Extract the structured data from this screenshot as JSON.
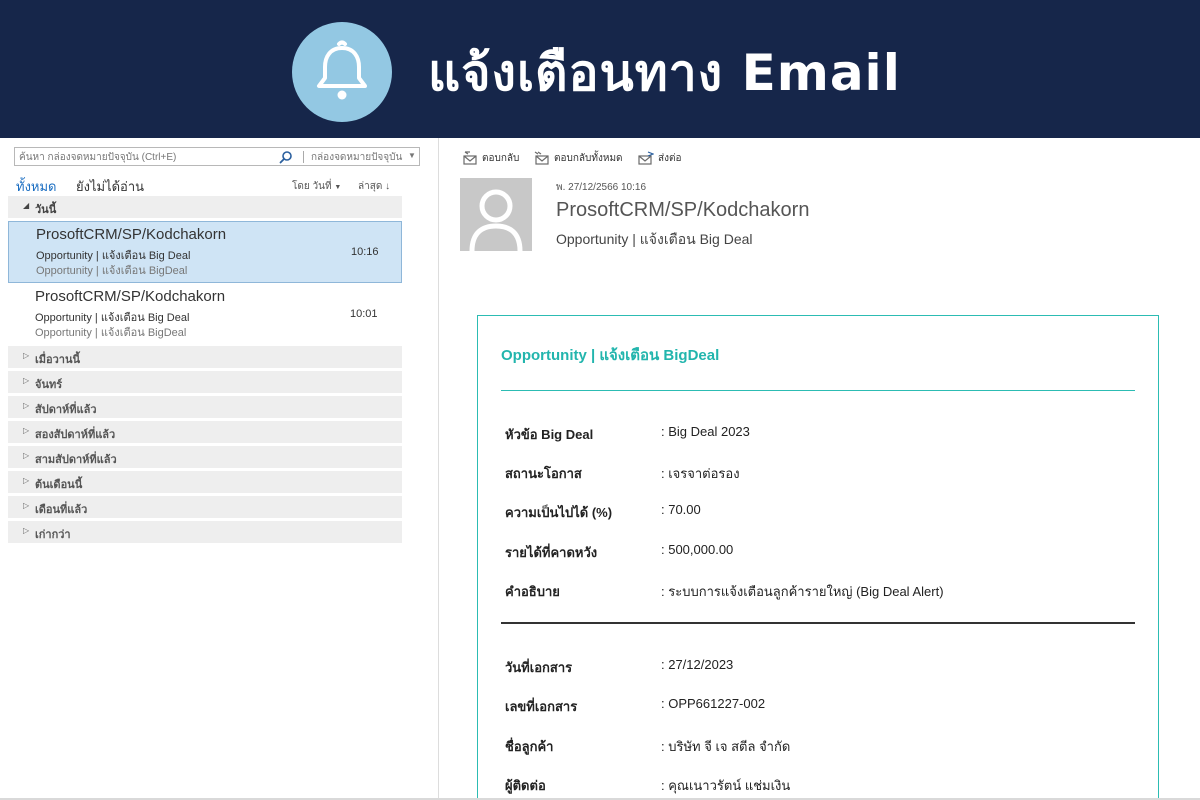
{
  "banner": {
    "title": "แจ้งเตือนทาง Email",
    "icon": "bell-icon",
    "background_color": "#16264a",
    "icon_circle_color": "#93c8e3"
  },
  "mail_list": {
    "search": {
      "placeholder": "ค้นหา กล่องจดหมายปัจจุบัน (Ctrl+E)",
      "scope": "กล่องจดหมายปัจจุบัน"
    },
    "filters": {
      "all": "ทั้งหมด",
      "unread": "ยังไม่ได้อ่าน",
      "sort_by": "โดย วันที่",
      "sort_order": "ล่าสุด"
    },
    "today_group": "วันนี้",
    "items": [
      {
        "sender": "ProsoftCRM/SP/Kodchakorn",
        "subject": "Opportunity | แจ้งเตือน Big Deal",
        "preview": "Opportunity | แจ้งเตือน BigDeal",
        "time": "10:16",
        "selected": true
      },
      {
        "sender": "ProsoftCRM/SP/Kodchakorn",
        "subject": "Opportunity | แจ้งเตือน Big Deal",
        "preview": "Opportunity | แจ้งเตือน BigDeal",
        "time": "10:01",
        "selected": false
      }
    ],
    "collapsed_groups": [
      "เมื่อวานนี้",
      "จันทร์",
      "สัปดาห์ที่แล้ว",
      "สองสัปดาห์ที่แล้ว",
      "สามสัปดาห์ที่แล้ว",
      "ต้นเดือนนี้",
      "เดือนที่แล้ว",
      "เก่ากว่า"
    ]
  },
  "reading_pane": {
    "actions": {
      "reply": "ตอบกลับ",
      "reply_all": "ตอบกลับทั้งหมด",
      "forward": "ส่งต่อ"
    },
    "date": "พ. 27/12/2566 10:16",
    "sender": "ProsoftCRM/SP/Kodchakorn",
    "subject": "Opportunity | แจ้งเตือน Big Deal",
    "card": {
      "title": "Opportunity | แจ้งเตือน BigDeal",
      "accent_color": "#22b5ad",
      "fields_top": [
        {
          "label": "หัวข้อ Big Deal",
          "value": ": Big Deal 2023"
        },
        {
          "label": "สถานะโอกาส",
          "value": ": เจรจาต่อรอง"
        },
        {
          "label": "ความเป็นไปได้ (%)",
          "value": ": 70.00"
        },
        {
          "label": "รายได้ที่คาดหวัง",
          "value": ": 500,000.00"
        },
        {
          "label": "คำอธิบาย",
          "value": ": ระบบการแจ้งเตือนลูกค้ารายใหญ่ (Big Deal Alert)"
        }
      ],
      "fields_bottom": [
        {
          "label": "วันที่เอกสาร",
          "value": ": 27/12/2023"
        },
        {
          "label": "เลขที่เอกสาร",
          "value": ": OPP661227-002"
        },
        {
          "label": "ชื่อลูกค้า",
          "value": ": บริษัท จี เจ สตีล จำกัด"
        },
        {
          "label": "ผู้ติดต่อ",
          "value": ": คุณเนาวรัตน์ แช่มเงิน"
        }
      ]
    }
  }
}
